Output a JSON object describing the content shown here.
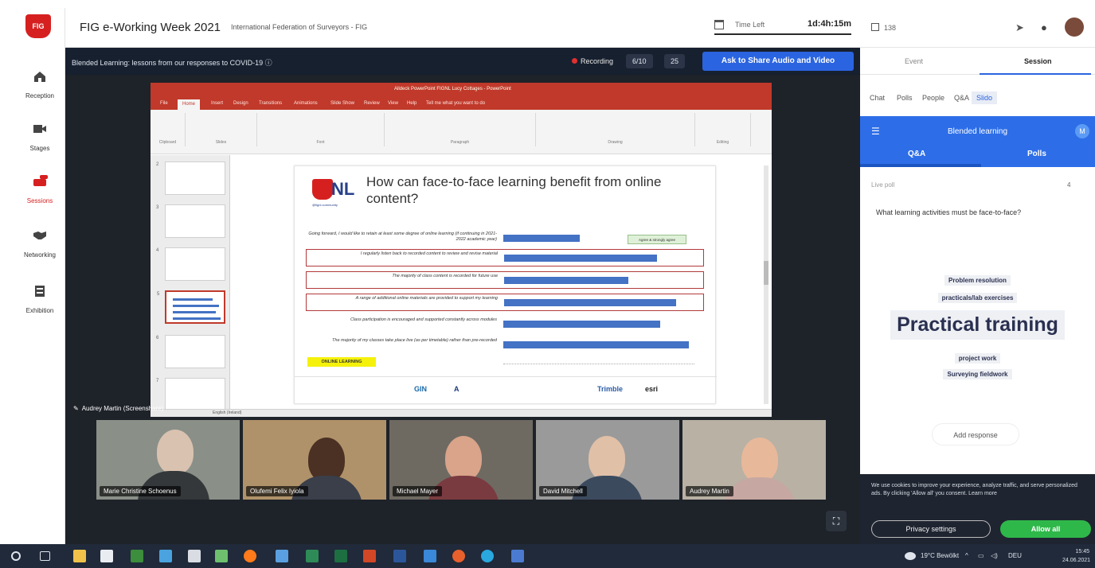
{
  "nav": {
    "logo_text": "FIG",
    "items": [
      {
        "label": "Reception"
      },
      {
        "label": "Stages"
      },
      {
        "label": "Sessions"
      },
      {
        "label": "Networking"
      },
      {
        "label": "Exhibition"
      }
    ]
  },
  "header": {
    "title": "FIG e-Working Week 2021",
    "subtitle": "International Federation of Surveyors - FIG",
    "time_left_label": "Time Left",
    "time_left_value": "1d:4h:15m",
    "viewers": "138"
  },
  "stage": {
    "session_title": "Blended Learning: lessons from our responses to COVID-19 ⓘ",
    "recording_label": "Recording",
    "chip_1": "6/10",
    "chip_2": "25",
    "share_button": "Ask to Share Audio and Video",
    "presenter_label": "Audrey Martin (Screenshare)"
  },
  "powerpoint": {
    "window_title": "Alldeck PowerPoint FIGNL Lucy Cottages - PowerPoint",
    "tabs": [
      "File",
      "Home",
      "Insert",
      "Design",
      "Transitions",
      "Animations",
      "Slide Show",
      "Review",
      "View",
      "Help",
      "Tell me what you want to do"
    ],
    "groups": [
      "Clipboard",
      "Slides",
      "Font",
      "Paragraph",
      "Drawing",
      "Editing"
    ],
    "status": "English (Ireland)"
  },
  "slide": {
    "logo_text": "NL",
    "logo_sub": "@fignl.community",
    "title": "How can face-to-face learning benefit from online content?",
    "legend": "Agree & strongly agree",
    "online_tag": "ONLINE LEARNING",
    "sponsors": [
      "GIN",
      "A",
      "Trimble",
      "esri"
    ]
  },
  "chart_data": {
    "type": "bar",
    "orientation": "horizontal",
    "categories": [
      "Going forward, I would like to retain at least some degree of online learning (if continuing in 2021-2022 academic year)",
      "I regularly listen back to recorded content to review and revise material",
      "The majority of class content is recorded for future use",
      "A range of additional online materials are provided to support my learning",
      "Class participation is encouraged and supported constantly across modules",
      "The majority of my classes take place live (as per timetable) rather than pre-recorded"
    ],
    "series": [
      {
        "name": "Agree & strongly agree",
        "values": [
          0.4,
          0.8,
          0.65,
          0.9,
          0.82,
          0.97
        ]
      }
    ],
    "xlim": [
      0,
      1
    ],
    "grid": false,
    "legend": "top-right"
  },
  "participants": [
    {
      "name": "Marie Christine Schoenus"
    },
    {
      "name": "Olufemi Felix Iyiola"
    },
    {
      "name": "Michael Mayer"
    },
    {
      "name": "David Mitchell"
    },
    {
      "name": "Audrey Martin"
    }
  ],
  "right_panel": {
    "tab_event": "Event",
    "tab_session": "Session",
    "sub_tabs": [
      "Chat",
      "Polls",
      "People",
      "Q&A",
      "Slido"
    ],
    "slido_title": "Blended learning",
    "avatar_initial": "M",
    "slido_tab_qa": "Q&A",
    "slido_tab_polls": "Polls",
    "live_poll_label": "Live poll",
    "live_poll_count": "4",
    "poll_question": "What learning activities must be face-to-face?",
    "words": [
      {
        "text": "Problem resolution"
      },
      {
        "text": "practicals/lab exercises"
      },
      {
        "text": "Practical training"
      },
      {
        "text": "project work"
      },
      {
        "text": "Surveying fieldwork"
      }
    ],
    "add_response": "Add response"
  },
  "cookie": {
    "text": "We use cookies to improve your experience, analyze traffic, and serve personalized ads. By clicking 'Allow all' you consent. Learn more",
    "privacy_button": "Privacy settings",
    "allow_button": "Allow all"
  },
  "taskbar": {
    "weather": "19°C Bewölkt",
    "lang": "DEU",
    "time": "15:45",
    "date": "24.06.2021"
  }
}
